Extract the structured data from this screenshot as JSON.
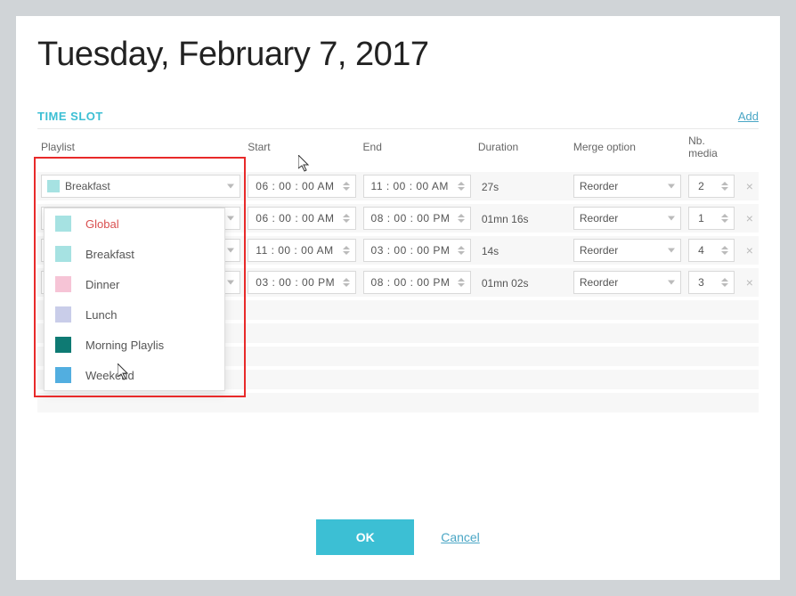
{
  "title": "Tuesday, February 7, 2017",
  "section_label": "TIME SLOT",
  "add_label": "Add",
  "columns": {
    "playlist": "Playlist",
    "start": "Start",
    "end": "End",
    "duration": "Duration",
    "merge": "Merge option",
    "nb": "Nb. media"
  },
  "rows": [
    {
      "playlist": "Breakfast",
      "swatch": "#a6e2e2",
      "start": "06 : 00 : 00 AM",
      "end": "11 : 00 : 00 AM",
      "duration": "27s",
      "merge": "Reorder",
      "nb": "2"
    },
    {
      "playlist": "",
      "swatch": "",
      "start": "06 : 00 : 00 AM",
      "end": "08 : 00 : 00 PM",
      "duration": "01mn 16s",
      "merge": "Reorder",
      "nb": "1"
    },
    {
      "playlist": "",
      "swatch": "",
      "start": "11 : 00 : 00 AM",
      "end": "03 : 00 : 00 PM",
      "duration": "14s",
      "merge": "Reorder",
      "nb": "4"
    },
    {
      "playlist": "",
      "swatch": "",
      "start": "03 : 00 : 00 PM",
      "end": "08 : 00 : 00 PM",
      "duration": "01mn 02s",
      "merge": "Reorder",
      "nb": "3"
    }
  ],
  "dropdown": {
    "items": [
      {
        "label": "Global",
        "color": "#a6e2e2",
        "selected": true
      },
      {
        "label": "Breakfast",
        "color": "#a6e2e2",
        "selected": false
      },
      {
        "label": "Dinner",
        "color": "#f6c4d6",
        "selected": false
      },
      {
        "label": "Lunch",
        "color": "#c9cde9",
        "selected": false
      },
      {
        "label": "Morning Playlis",
        "color": "#0e7a73",
        "selected": false
      },
      {
        "label": "Weekend",
        "color": "#52aee0",
        "selected": false
      }
    ]
  },
  "footer": {
    "ok": "OK",
    "cancel": "Cancel"
  }
}
